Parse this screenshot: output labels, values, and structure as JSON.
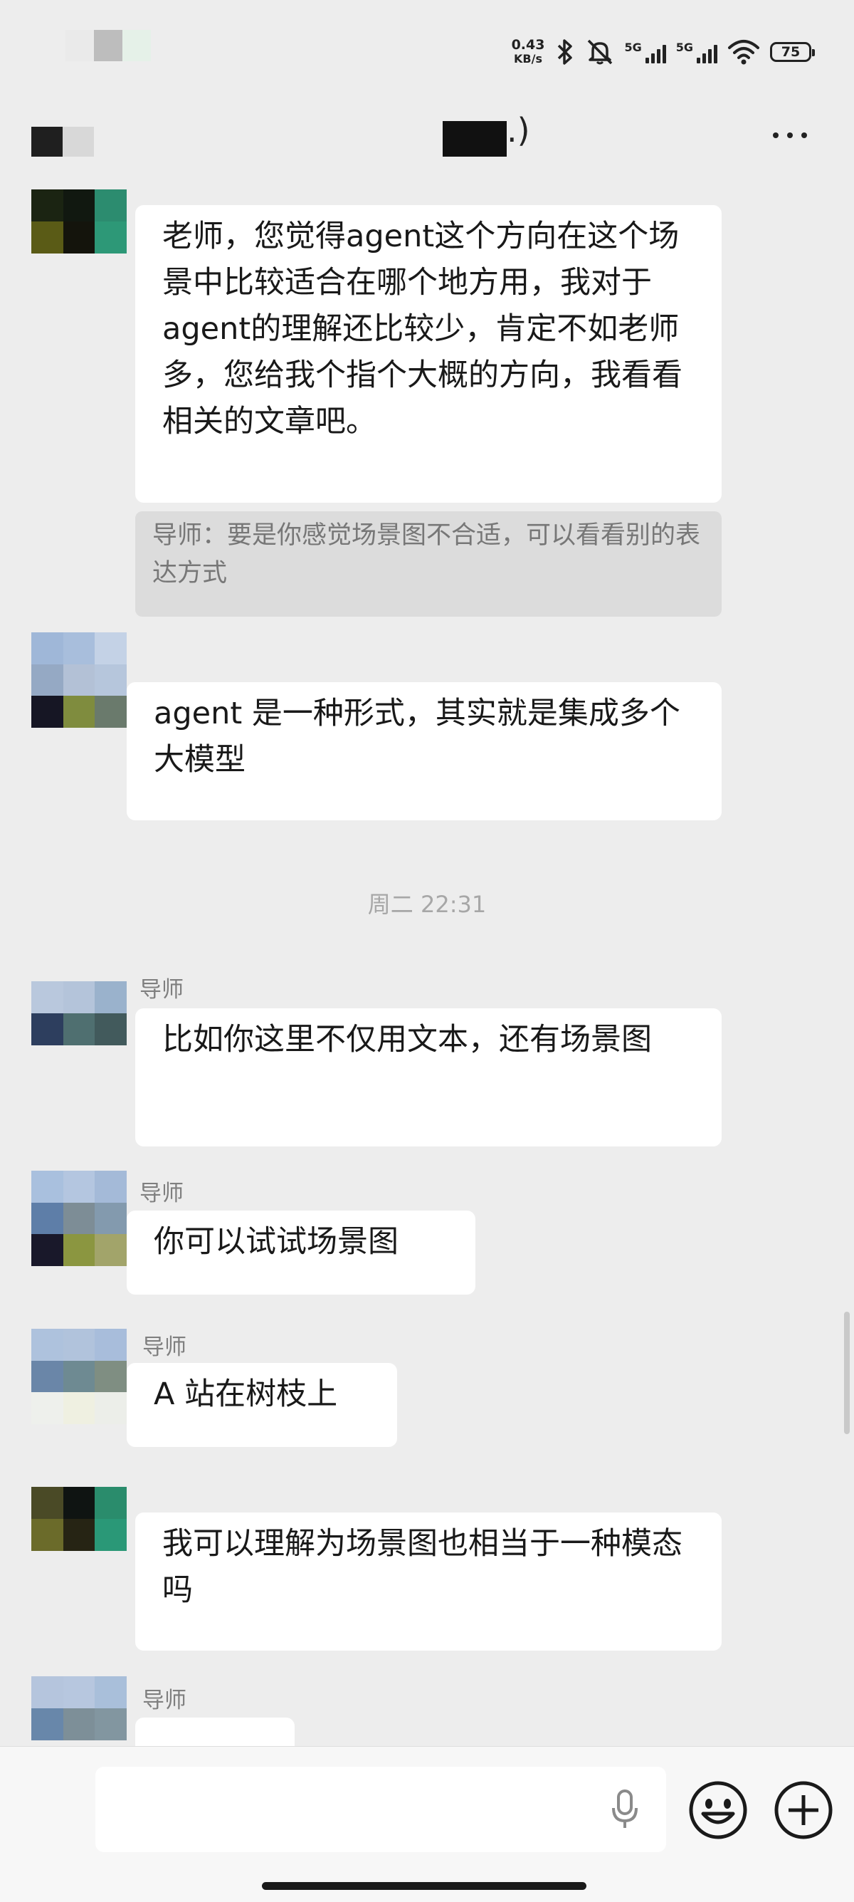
{
  "status_bar": {
    "net_speed_value": "0.43",
    "net_speed_unit": "KB/s",
    "signal1_label": "5G",
    "signal2_label": "5G",
    "battery": "75"
  },
  "header": {
    "title_suffix": ".)"
  },
  "messages": [
    {
      "sender": "",
      "text": "老师，您觉得agent这个方向在这个场景中比较适合在哪个地方用，我对于agent的理解还比较少，肯定不如老师多，您给我个指个大概的方向，我看看相关的文章吧。"
    },
    {
      "quote": "导师：要是你感觉场景图不合适，可以看看别的表达方式"
    },
    {
      "sender": "",
      "text": "agent 是一种形式，其实就是集成多个大模型"
    },
    {
      "time": "周二 22:31"
    },
    {
      "sender": "导师",
      "text": "比如你这里不仅用文本，还有场景图"
    },
    {
      "sender": "导师",
      "text": "你可以试试场景图"
    },
    {
      "sender": "导师",
      "text": "A 站在树枝上"
    },
    {
      "sender": "",
      "text": "我可以理解为场景图也相当于一种模态吗"
    },
    {
      "sender": "导师",
      "text": ""
    }
  ],
  "input_bar": {
    "placeholder": "",
    "value": ""
  },
  "icons": {
    "bluetooth": "bluetooth-icon",
    "mute": "bell-off-icon",
    "wifi": "wifi-icon",
    "more": "more-icon",
    "mic": "mic-icon",
    "emoji": "emoji-icon",
    "plus": "plus-icon"
  }
}
